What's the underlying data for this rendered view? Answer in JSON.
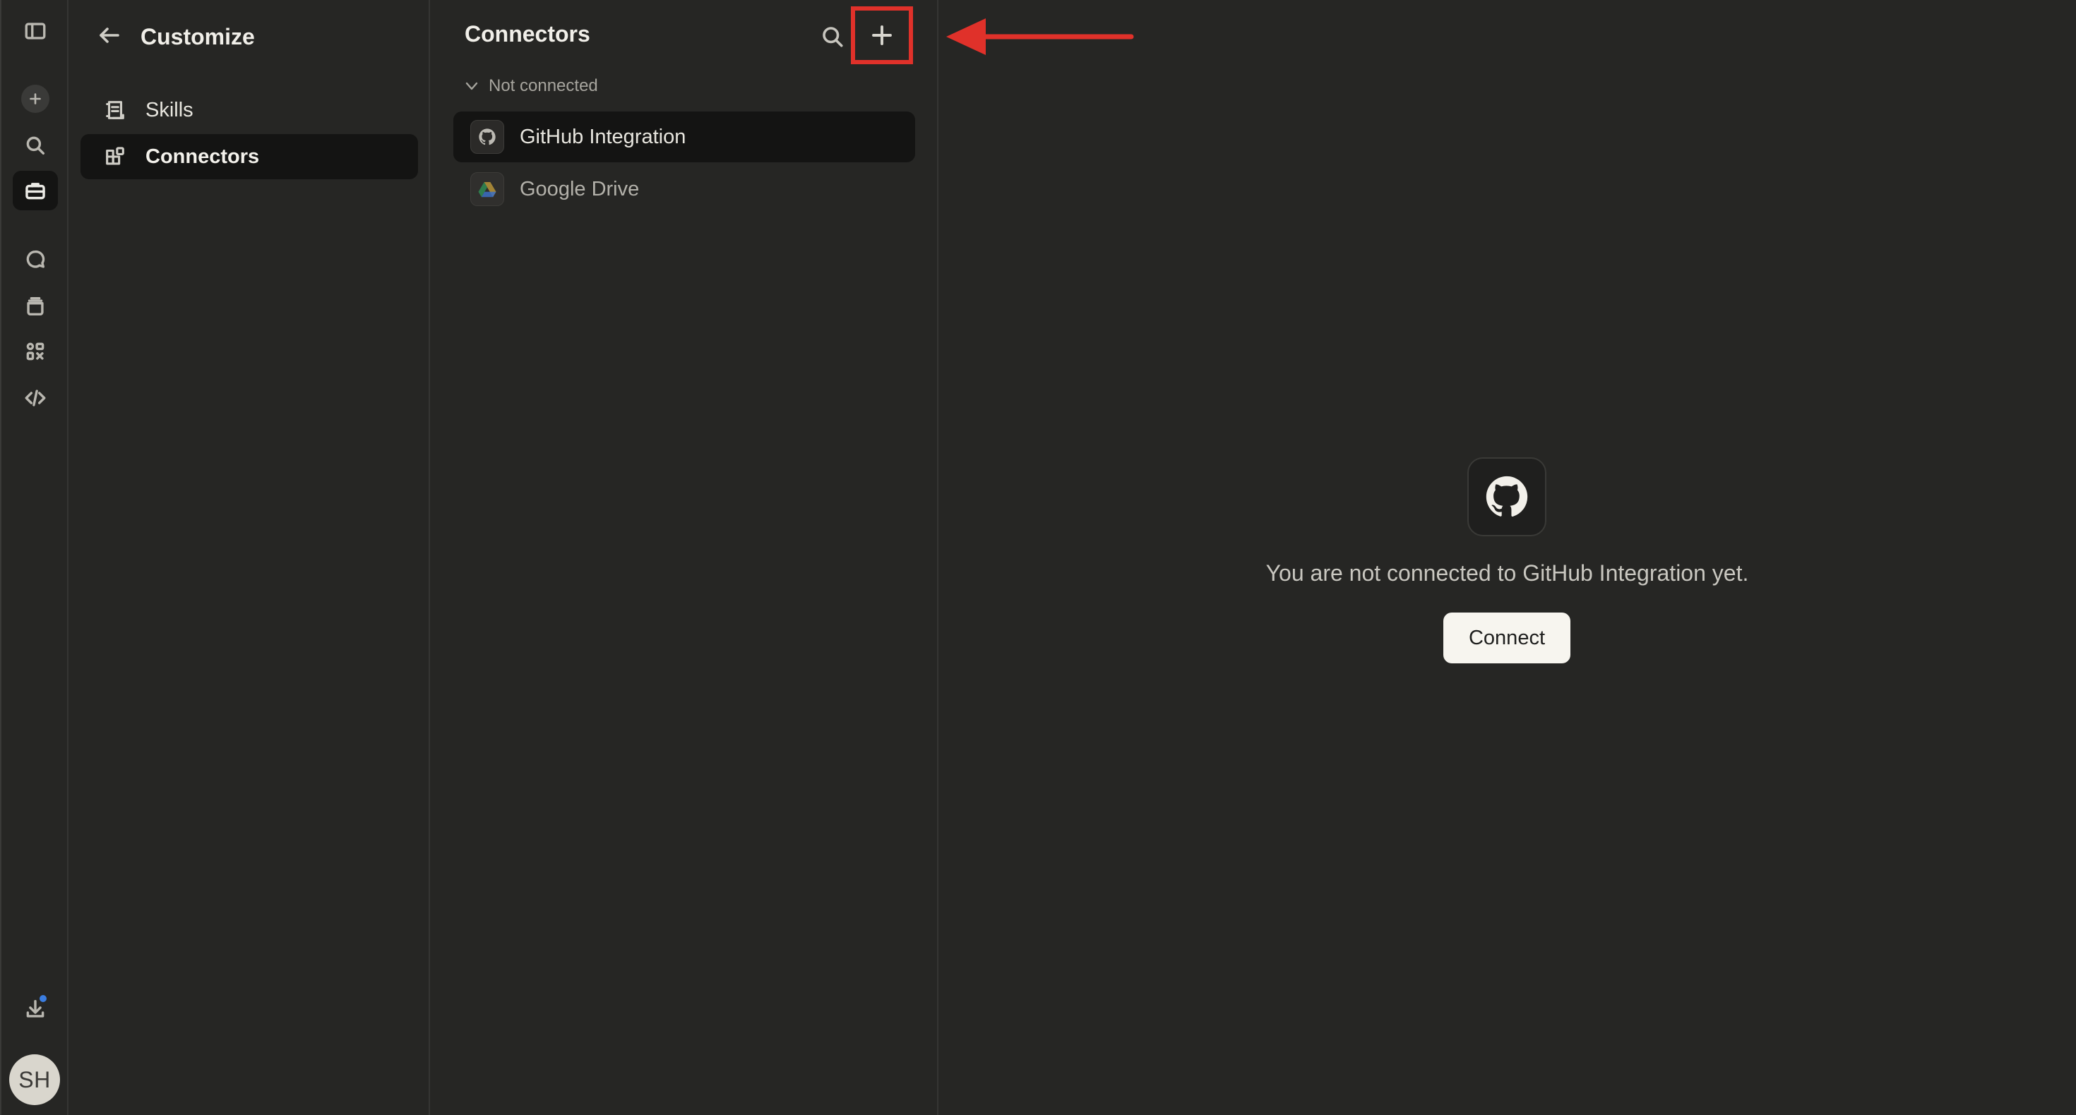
{
  "rail": {
    "items": [
      {
        "name": "sidebar-toggle-icon"
      },
      {
        "name": "new-chat-icon"
      },
      {
        "name": "search-icon"
      },
      {
        "name": "customize-toolbox-icon",
        "active": true
      },
      {
        "name": "chats-icon"
      },
      {
        "name": "projects-icon"
      },
      {
        "name": "artifacts-icon"
      },
      {
        "name": "code-icon"
      },
      {
        "name": "download-icon",
        "badge": true
      }
    ],
    "avatar_initials": "SH",
    "badge_color": "#3b7de0"
  },
  "customize": {
    "title": "Customize",
    "nav": [
      {
        "label": "Skills",
        "icon": "skills-icon",
        "active": false
      },
      {
        "label": "Connectors",
        "icon": "connectors-icon",
        "active": true
      }
    ]
  },
  "connectors": {
    "title": "Connectors",
    "section_label": "Not connected",
    "items": [
      {
        "label": "GitHub Integration",
        "icon": "github-icon",
        "active": true
      },
      {
        "label": "Google Drive",
        "icon": "google-drive-icon",
        "active": false
      }
    ]
  },
  "detail": {
    "message": "You are not connected to GitHub Integration yet.",
    "connect_label": "Connect",
    "logo_icon": "github-icon"
  },
  "annotation": {
    "highlight_color": "#e0312a",
    "target": "add-connector-button"
  }
}
